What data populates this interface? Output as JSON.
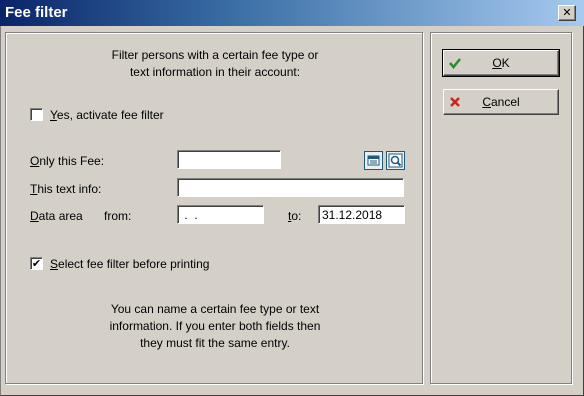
{
  "window": {
    "title": "Fee filter",
    "close_glyph": "✕"
  },
  "intro": {
    "line1": "Filter persons with a certain fee type or",
    "line2": "text information in their account:"
  },
  "activate": {
    "label_key": "Y",
    "label_rest": "es, activate fee filter",
    "checked": false
  },
  "fields": {
    "fee_label_key": "O",
    "fee_label_rest": "nly this Fee:",
    "fee_value": "",
    "text_label_key": "T",
    "text_label_rest": "his text info:",
    "text_value": "",
    "data_label_key": "D",
    "data_label_rest": "ata area",
    "from_label": "from:",
    "from_value": " .  .",
    "to_label_key": "t",
    "to_label_rest": "o:",
    "to_value": "31.12.2018"
  },
  "select_before_print": {
    "label_key": "S",
    "label_rest": "elect fee filter before printing",
    "checked": true,
    "check_glyph": "✔"
  },
  "footer": {
    "line1": "You can name a certain fee type or text",
    "line2": "information. If you enter both fields then",
    "line3": "they must fit the same entry."
  },
  "buttons": {
    "ok_key": "O",
    "ok_rest": "K",
    "ok_icon": "checkmark-icon",
    "ok_icon_color": "#2e8b2e",
    "cancel_key": "C",
    "cancel_rest": "ancel",
    "cancel_icon": "red-x-icon",
    "cancel_icon_color": "#cc2222"
  },
  "lookup_icons": {
    "list": "list-lookup-icon",
    "search": "magnifier-icon",
    "accent": "#1f5a7a"
  }
}
